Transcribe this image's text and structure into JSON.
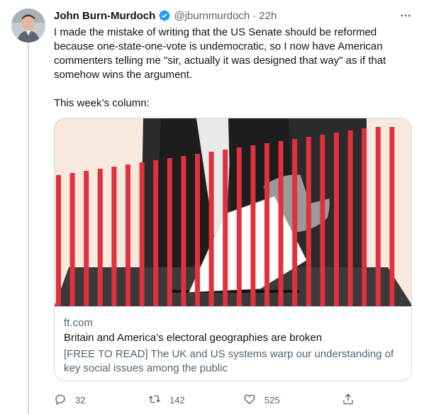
{
  "tweet": {
    "author_name": "John Burn-Murdoch",
    "handle": "@jburnmurdoch",
    "separator": "·",
    "time": "22h",
    "text": "I made the mistake of writing that the US Senate should be reformed because one-state-one-vote is undemocratic, so I now have American commenters telling me \"sir, actually it was designed that way\" as if that somehow wins the argument.\n\nThis week’s column:",
    "verified": true,
    "icons": {
      "verified": "verified-badge-icon",
      "more": "more-icon"
    }
  },
  "card": {
    "domain": "ft.com",
    "title": "Britain and America’s electoral geographies are broken",
    "description": "[FREE TO READ] The UK and US systems warp our understanding of key social issues among the public",
    "image_description_colors": {
      "background": "#f7e9dd",
      "bars": "#e0313d"
    }
  },
  "actions": {
    "reply_count": "32",
    "retweet_count": "142",
    "like_count": "525",
    "icons": {
      "reply": "reply-icon",
      "retweet": "retweet-icon",
      "like": "like-icon",
      "share": "share-icon"
    }
  },
  "colors": {
    "accent": "#1d9bf0",
    "text": "#0f1419",
    "secondary": "#536471",
    "border": "#cfd9de"
  }
}
